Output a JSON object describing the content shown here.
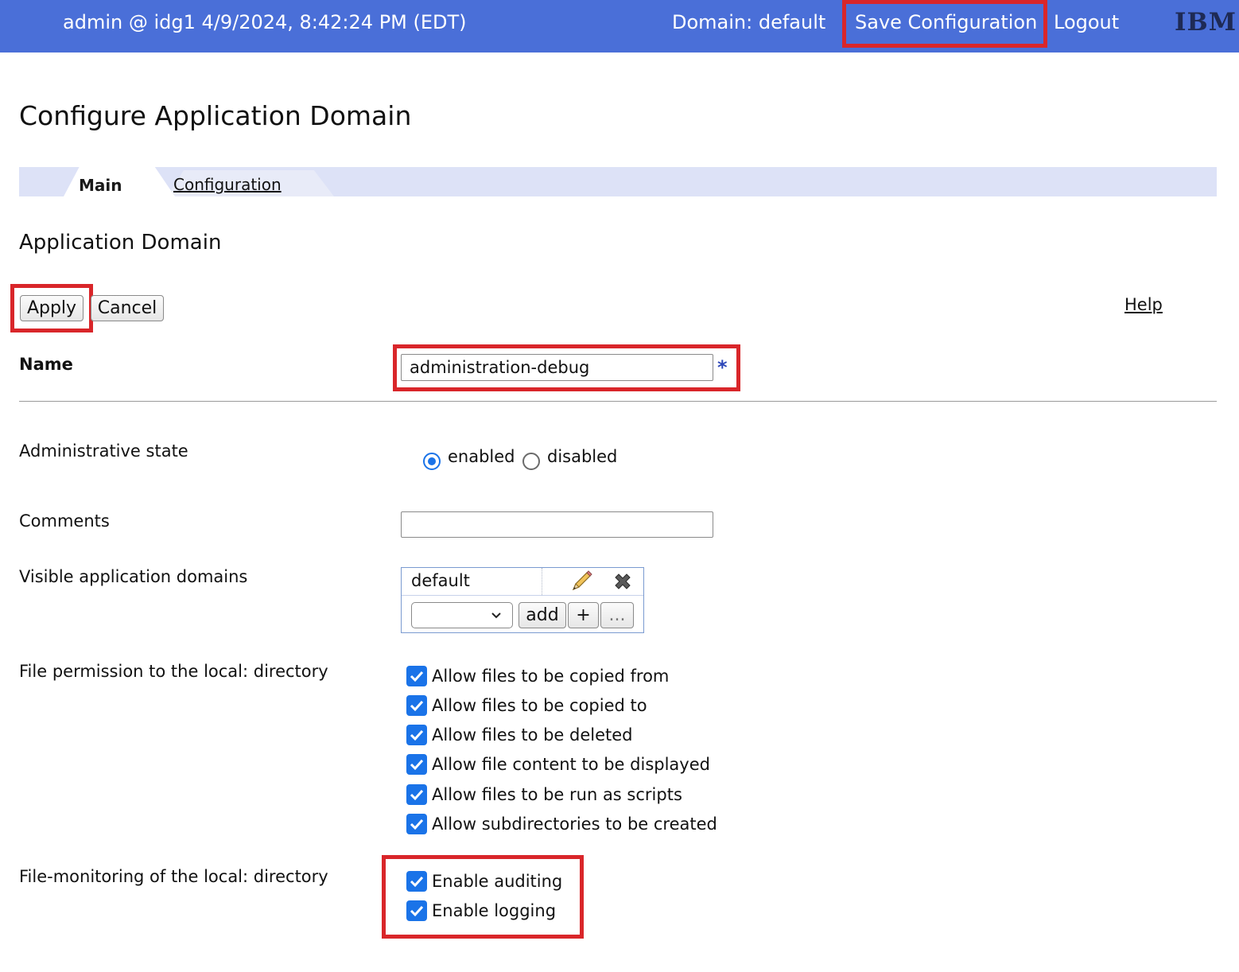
{
  "header": {
    "user_info": "admin @ idg1 4/9/2024, 8:42:24 PM (EDT)",
    "domain": "Domain: default",
    "save_configuration": "Save Configuration",
    "logout": "Logout",
    "logo": "IBM",
    "color": "#4a6fd8"
  },
  "page": {
    "title": "Configure Application Domain",
    "tabs": [
      "Main",
      "Configuration"
    ],
    "active_tab": "Main",
    "section_title": "Application Domain"
  },
  "actions": {
    "apply": "Apply",
    "cancel": "Cancel",
    "help": "Help"
  },
  "form": {
    "name": {
      "label": "Name",
      "value": "administration-debug",
      "required_marker": "*"
    },
    "admin_state": {
      "label": "Administrative state",
      "options": [
        "enabled",
        "disabled"
      ],
      "selected": "enabled"
    },
    "comments": {
      "label": "Comments",
      "value": ""
    },
    "visible_domains": {
      "label": "Visible application domains",
      "items": [
        "default"
      ],
      "select_value": "",
      "add_button": "add",
      "plus_button": "+",
      "more_button": "..."
    },
    "file_permission": {
      "label": "File permission to the local: directory",
      "options": [
        {
          "label": "Allow files to be copied from",
          "checked": true
        },
        {
          "label": "Allow files to be copied to",
          "checked": true
        },
        {
          "label": "Allow files to be deleted",
          "checked": true
        },
        {
          "label": "Allow file content to be displayed",
          "checked": true
        },
        {
          "label": "Allow files to be run as scripts",
          "checked": true
        },
        {
          "label": "Allow subdirectories to be created",
          "checked": true
        }
      ]
    },
    "file_monitoring": {
      "label": "File-monitoring of the local: directory",
      "options": [
        {
          "label": "Enable auditing",
          "checked": true
        },
        {
          "label": "Enable logging",
          "checked": true
        }
      ]
    }
  },
  "highlight_color": "#d9262a"
}
